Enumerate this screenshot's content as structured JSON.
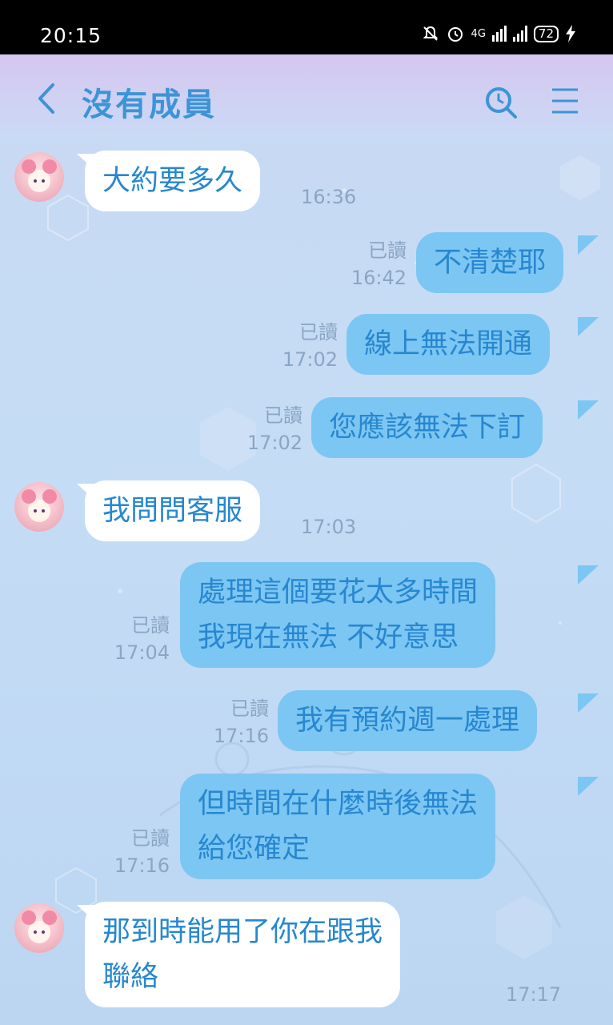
{
  "status_bar": {
    "time": "20:15",
    "network": "4G",
    "battery": "72",
    "icons": [
      "bell-off-icon",
      "alarm-icon",
      "signal-icon",
      "wifi-signal-icon",
      "battery-icon",
      "charging-icon"
    ]
  },
  "header": {
    "title": "沒有成員",
    "back_icon": "chevron-left-icon",
    "search_icon": "search-icon",
    "menu_icon": "menu-icon",
    "accent": "#3c94d6"
  },
  "messages": [
    {
      "side": "in",
      "lines": [
        "大約要多久"
      ],
      "time": "16:36"
    },
    {
      "side": "out",
      "lines": [
        "不清楚耶"
      ],
      "read": "已讀",
      "time": "16:42"
    },
    {
      "side": "out",
      "lines": [
        "線上無法開通"
      ],
      "read": "已讀",
      "time": "17:02"
    },
    {
      "side": "out",
      "lines": [
        "您應該無法下訂"
      ],
      "read": "已讀",
      "time": "17:02"
    },
    {
      "side": "in",
      "lines": [
        "我問問客服"
      ],
      "time": "17:03"
    },
    {
      "side": "out",
      "lines": [
        "處理這個要花太多時間",
        "我現在無法 不好意思"
      ],
      "read": "已讀",
      "time": "17:04"
    },
    {
      "side": "out",
      "lines": [
        "我有預約週一處理"
      ],
      "read": "已讀",
      "time": "17:16"
    },
    {
      "side": "out",
      "lines": [
        "但時間在什麼時後無法",
        "給您確定"
      ],
      "read": "已讀",
      "time": "17:16"
    },
    {
      "side": "in",
      "lines": [
        "那到時能用了你在跟我",
        "聯絡"
      ],
      "time": "17:17"
    }
  ],
  "colors": {
    "bubble_out": "#7cc6f3",
    "bubble_in": "#ffffff",
    "text": "#2787cf",
    "meta": "#8aa6c4"
  }
}
